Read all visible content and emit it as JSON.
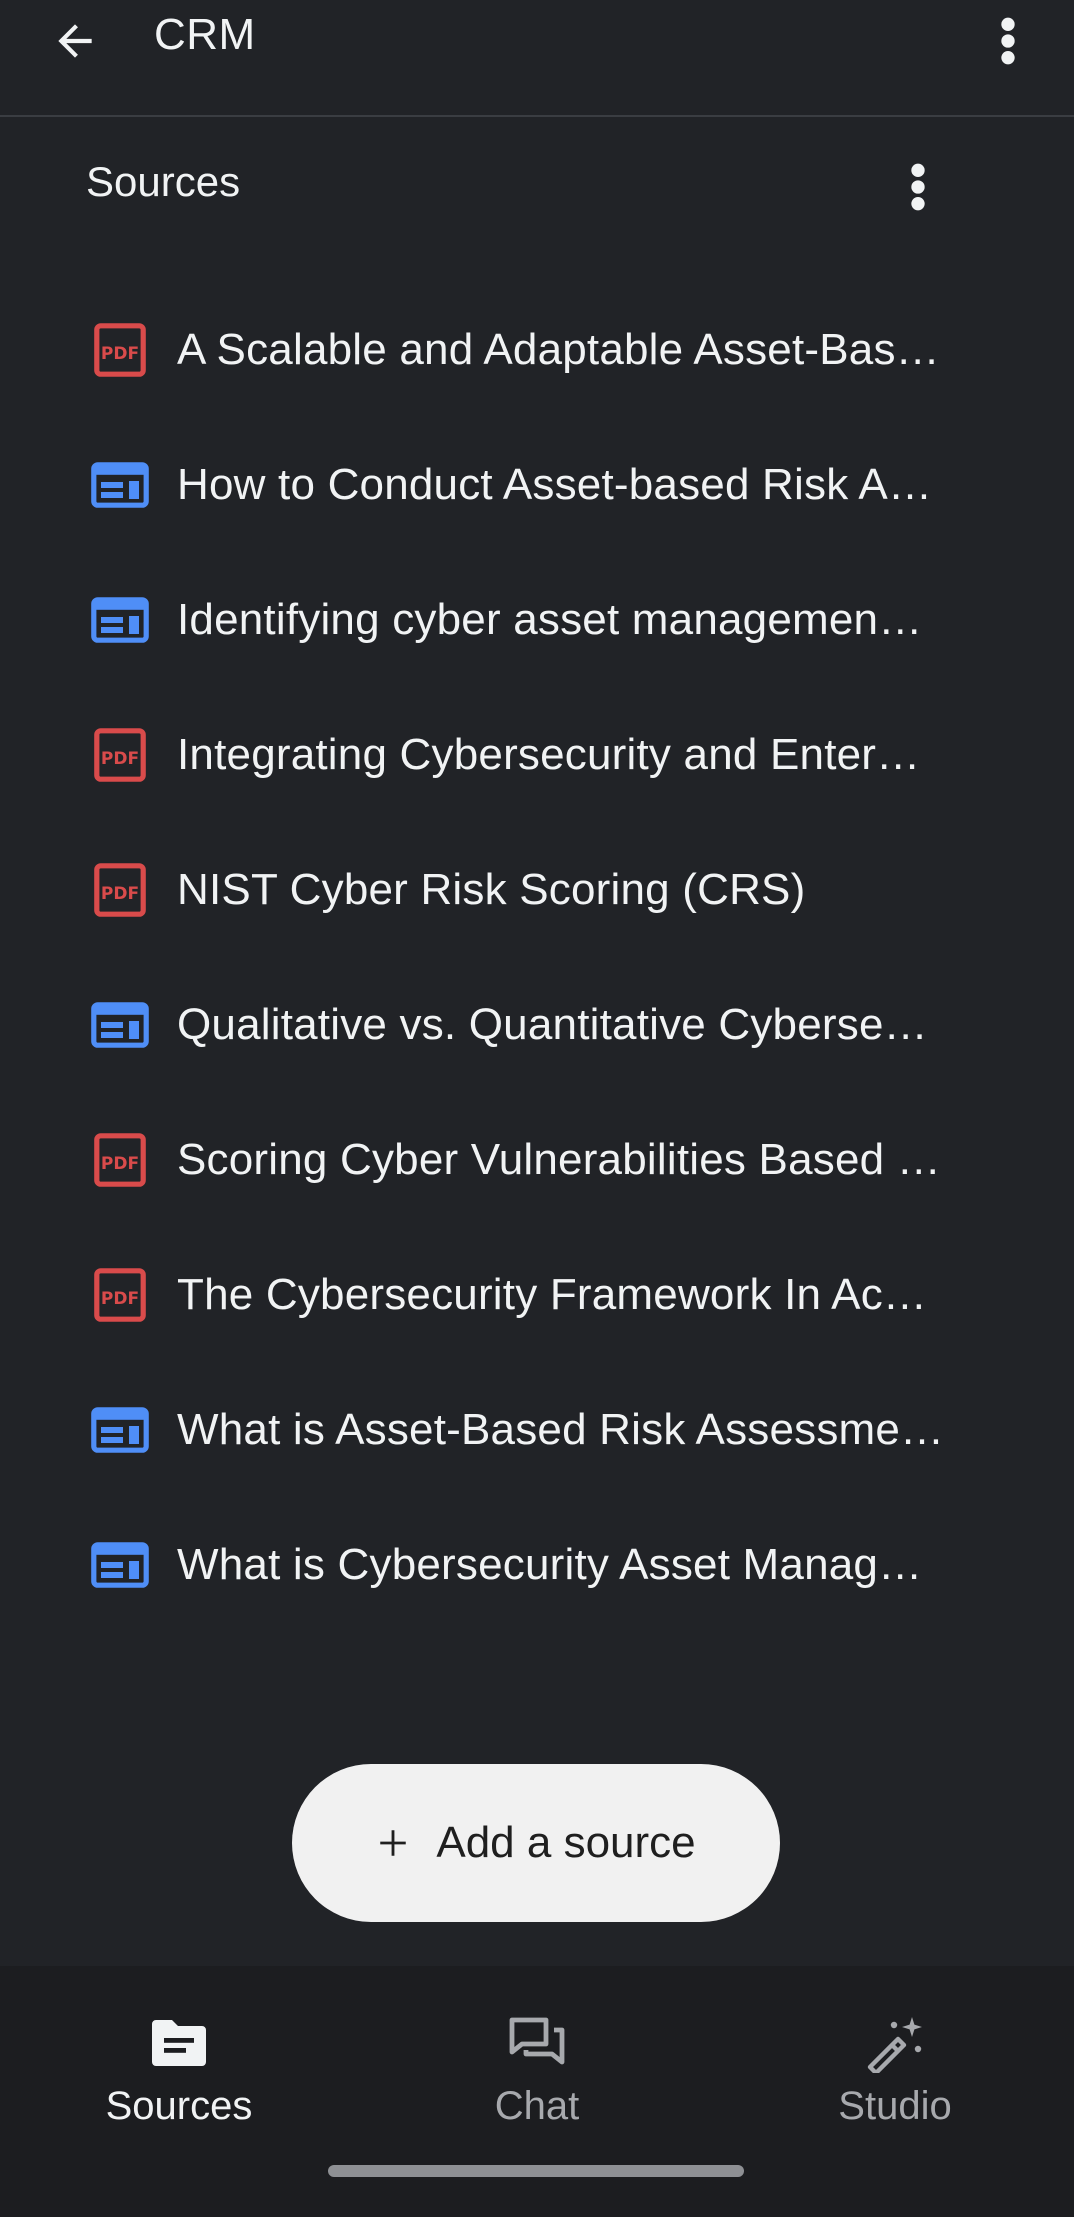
{
  "app": {
    "title": "CRM"
  },
  "icons": {
    "back": "arrow-back-icon",
    "more": "more-vert-icon",
    "pdf": "pdf-icon",
    "web": "web-page-icon",
    "add": "plus-icon",
    "sources": "sources-icon",
    "chat": "chat-icon",
    "studio": "magic-wand-icon"
  },
  "colors": {
    "background": "#212327",
    "pdf_icon": "#d94b4b",
    "web_icon": "#4f8ef7",
    "button_bg": "#f1f1f1",
    "nav_bg": "#1c1d20"
  },
  "sources": {
    "header": "Sources",
    "items": [
      {
        "type": "pdf",
        "title": "A Scalable and Adaptable Asset-Bas…"
      },
      {
        "type": "web",
        "title": "How to Conduct Asset-based Risk A…"
      },
      {
        "type": "web",
        "title": "Identifying cyber asset managemen…"
      },
      {
        "type": "pdf",
        "title": "Integrating Cybersecurity and Enter…"
      },
      {
        "type": "pdf",
        "title": "NIST Cyber Risk Scoring (CRS)"
      },
      {
        "type": "web",
        "title": "Qualitative vs. Quantitative Cyberse…"
      },
      {
        "type": "pdf",
        "title": "Scoring Cyber Vulnerabilities Based …"
      },
      {
        "type": "pdf",
        "title": "The Cybersecurity Framework In Ac…"
      },
      {
        "type": "web",
        "title": "What is Asset-Based Risk Assessme…"
      },
      {
        "type": "web",
        "title": "What is Cybersecurity Asset Manag…"
      }
    ]
  },
  "add_source": {
    "label": "Add a source"
  },
  "bottom_nav": {
    "items": [
      {
        "label": "Sources",
        "active": true
      },
      {
        "label": "Chat",
        "active": false
      },
      {
        "label": "Studio",
        "active": false
      }
    ]
  }
}
